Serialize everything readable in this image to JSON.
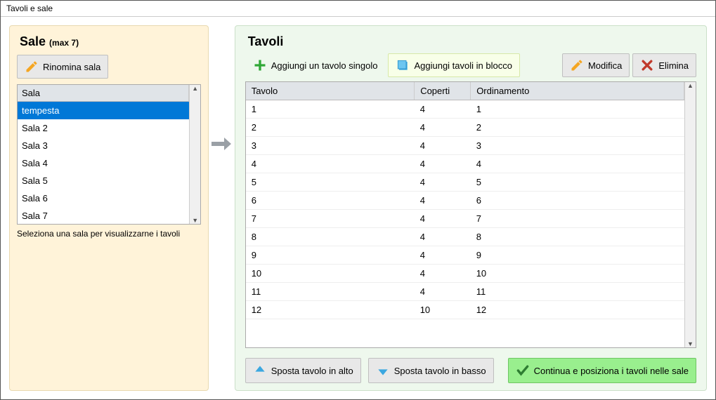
{
  "window": {
    "title": "Tavoli e sale"
  },
  "sale": {
    "title": "Sale",
    "max": "(max 7)",
    "rename": "Rinomina sala",
    "header": "Sala",
    "items": [
      "tempesta",
      "Sala 2",
      "Sala 3",
      "Sala 4",
      "Sala 5",
      "Sala 6",
      "Sala 7"
    ],
    "selectedIndex": 0,
    "hint": "Seleziona una sala per visualizzarne i tavoli"
  },
  "tavoli": {
    "title": "Tavoli",
    "addSingle": "Aggiungi un tavolo singolo",
    "addBulk": "Aggiungi tavoli in blocco",
    "modify": "Modifica",
    "delete": "Elimina",
    "cols": [
      "Tavolo",
      "Coperti",
      "Ordinamento"
    ],
    "rows": [
      {
        "t": "1",
        "c": "4",
        "o": "1"
      },
      {
        "t": "2",
        "c": "4",
        "o": "2"
      },
      {
        "t": "3",
        "c": "4",
        "o": "3"
      },
      {
        "t": "4",
        "c": "4",
        "o": "4"
      },
      {
        "t": "5",
        "c": "4",
        "o": "5"
      },
      {
        "t": "6",
        "c": "4",
        "o": "6"
      },
      {
        "t": "7",
        "c": "4",
        "o": "7"
      },
      {
        "t": "8",
        "c": "4",
        "o": "8"
      },
      {
        "t": "9",
        "c": "4",
        "o": "9"
      },
      {
        "t": "10",
        "c": "4",
        "o": "10"
      },
      {
        "t": "11",
        "c": "4",
        "o": "11"
      },
      {
        "t": "12",
        "c": "10",
        "o": "12"
      }
    ],
    "moveUp": "Sposta tavolo in alto",
    "moveDown": "Sposta tavolo in basso",
    "continue": "Continua e posiziona i tavoli nelle sale"
  }
}
